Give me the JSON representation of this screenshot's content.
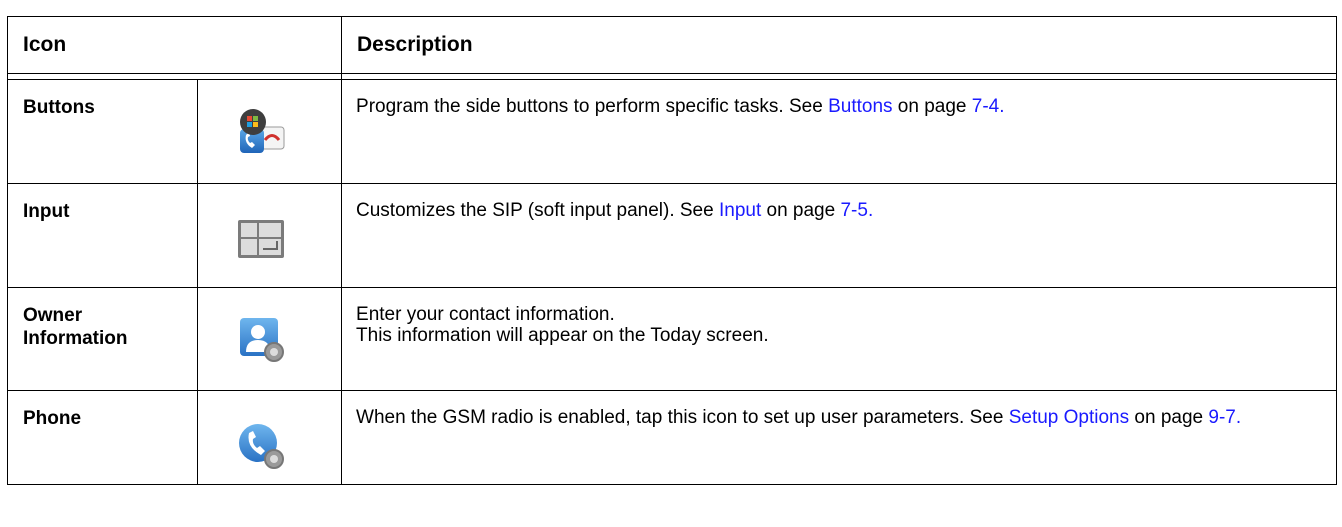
{
  "header": {
    "icon": "Icon",
    "description": "Description"
  },
  "rows": [
    {
      "name": "Buttons",
      "icon_name": "buttons-icon",
      "text_before": "Program the side buttons to perform specific tasks. See ",
      "link": "Buttons",
      "text_middle": " on page ",
      "page_ref": "7-4."
    },
    {
      "name": "Input",
      "icon_name": "input-panel-icon",
      "text_before": "Customizes the SIP (soft input panel). See ",
      "link": "Input",
      "text_middle": " on page ",
      "page_ref": "7-5."
    },
    {
      "name_line1": "Owner",
      "name_line2": "Information",
      "icon_name": "owner-information-icon",
      "line1": "Enter your contact information.",
      "line2": "This information will appear on the Today screen."
    },
    {
      "name": "Phone",
      "icon_name": "phone-settings-icon",
      "text_before": "When the GSM radio is enabled, tap this icon to set up user parameters. See ",
      "link": "Setup Options",
      "text_middle": " on page ",
      "page_ref": "9-7."
    }
  ],
  "colors": {
    "link": "#1a1aff",
    "border": "#000000"
  }
}
